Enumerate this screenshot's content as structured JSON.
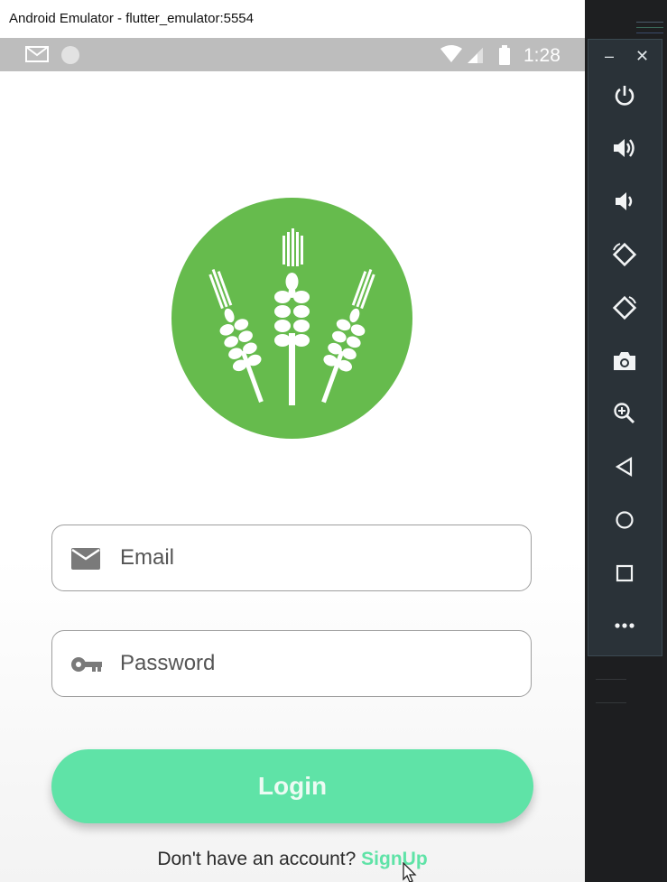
{
  "window": {
    "title": "Android Emulator - flutter_emulator:5554"
  },
  "status_bar": {
    "time": "1:28",
    "icons": [
      "gmail-icon",
      "circle-icon",
      "wifi-icon",
      "signal-icon",
      "battery-icon"
    ]
  },
  "login": {
    "email_placeholder": "Email",
    "password_placeholder": "Password",
    "button_label": "Login",
    "signup_prompt": "Don't have an account?",
    "signup_link": "SignUp",
    "logo_icon": "wheat-icon",
    "colors": {
      "logo": "#66bb4d",
      "accent": "#5fe3a7"
    }
  },
  "emulator_toolbar": {
    "window_controls": [
      "minimize",
      "close"
    ],
    "buttons": [
      "power",
      "volume-up",
      "volume-down",
      "rotate-left",
      "rotate-right",
      "screenshot",
      "zoom",
      "back",
      "home",
      "overview",
      "more"
    ]
  }
}
